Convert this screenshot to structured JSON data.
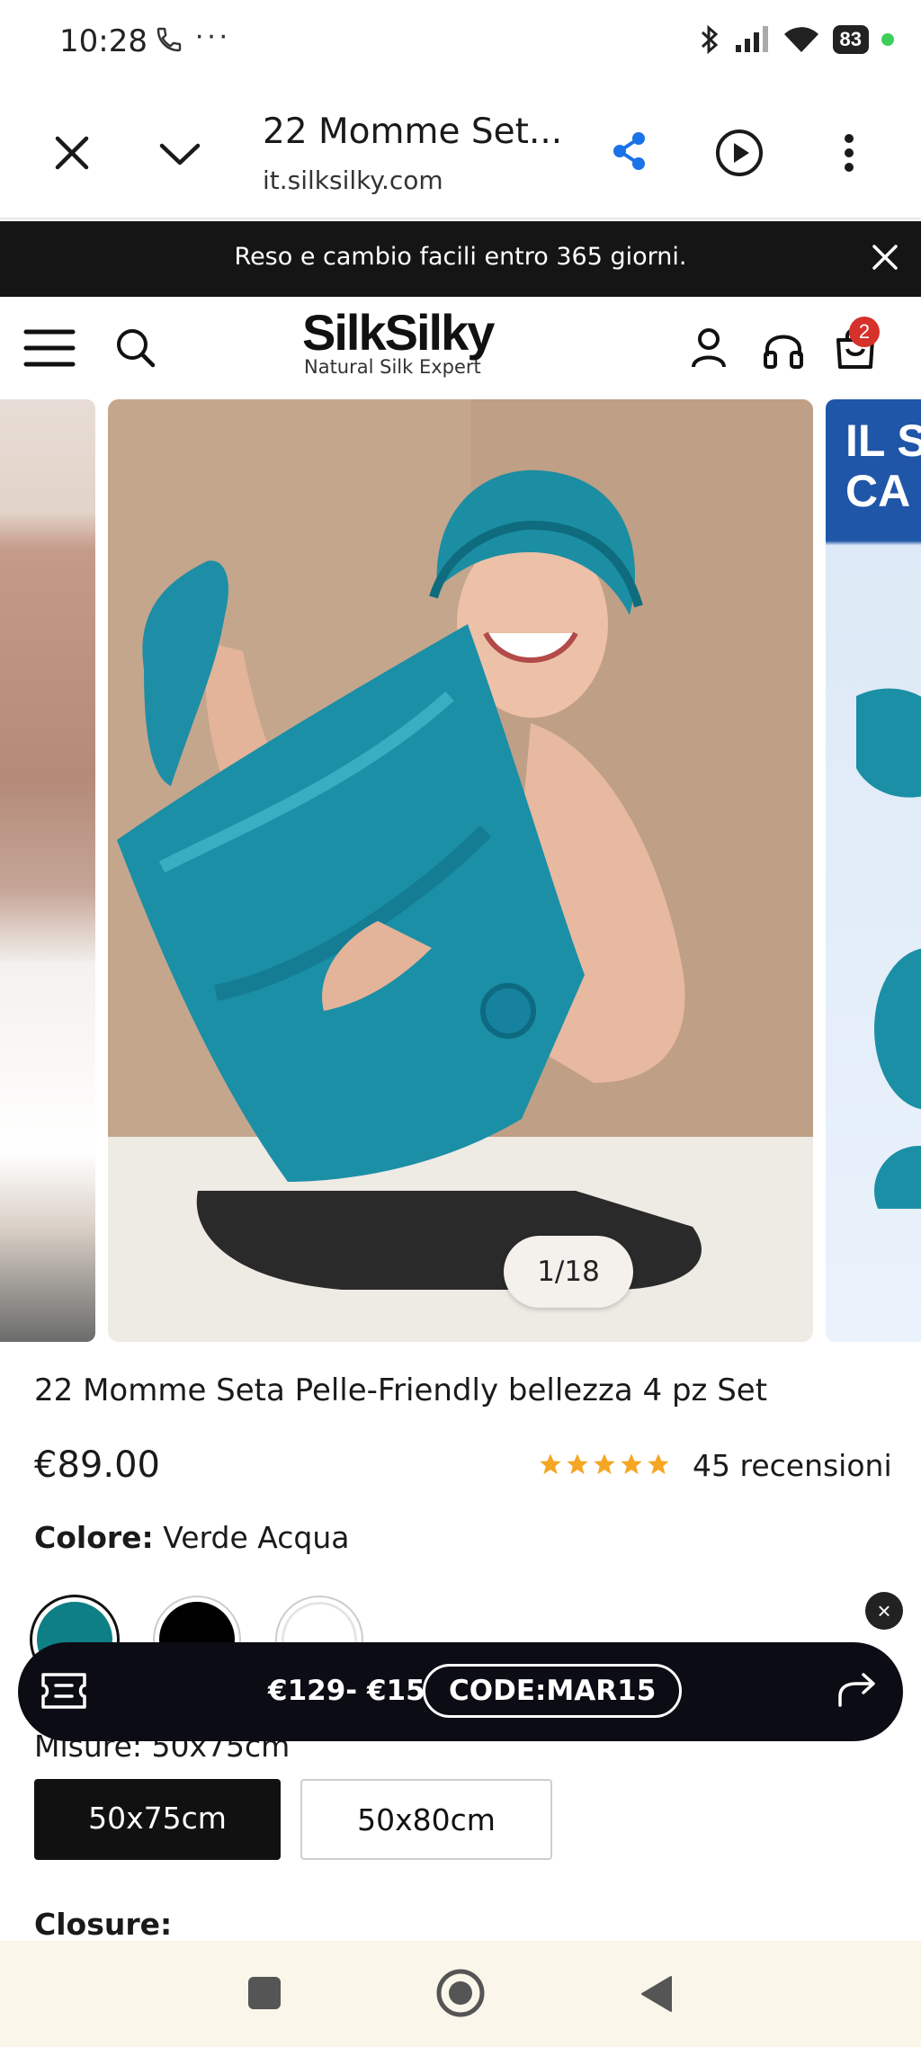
{
  "status_bar": {
    "time": "10:28",
    "dots": "···",
    "battery": "83"
  },
  "browser": {
    "title": "22 Momme Set...",
    "url": "it.silksilky.com"
  },
  "announcement": {
    "text": "Reso e cambio facili entro 365 giorni."
  },
  "header": {
    "logo_main": "SilkSilky",
    "logo_sub": "Natural Silk Expert",
    "cart_count": "2"
  },
  "gallery": {
    "next_slide_text_1": "IL S",
    "next_slide_text_2": "CA",
    "counter": "1/18"
  },
  "product": {
    "title": "22 Momme Seta Pelle-Friendly bellezza 4 pz Set",
    "price": "€89.00",
    "rating": 5,
    "reviews": "45 recensioni",
    "color_label": "Colore:",
    "color_value": "Verde Acqua",
    "swatches": [
      "#0f7f86",
      "#000000",
      "#ffffff"
    ]
  },
  "coupon": {
    "close": "×",
    "amount": "€129- €15",
    "code": "CODE:MAR15"
  },
  "sizes": {
    "label": "Misure: 50x75cm",
    "options": [
      "50x75cm",
      "50x80cm"
    ],
    "selected": "50x75cm"
  },
  "closure": {
    "label": "Closure:"
  },
  "colors": {
    "brand_dark": "#151515",
    "accent_blue": "#1a73e8",
    "badge_red": "#d6312b",
    "star": "#f5a623",
    "teal": "#1b8fa6"
  }
}
